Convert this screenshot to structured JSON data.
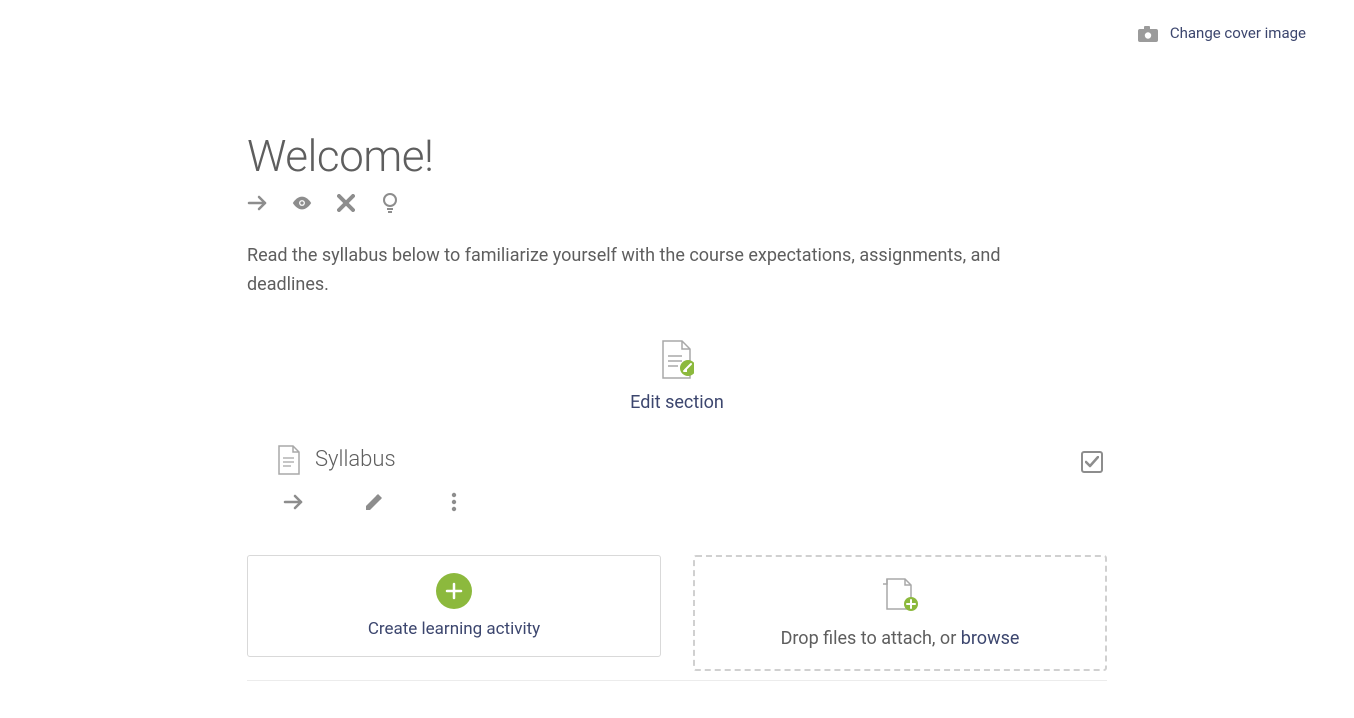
{
  "header": {
    "change_cover_label": "Change cover image"
  },
  "section": {
    "title": "Welcome!",
    "description": "Read the syllabus below to familiarize yourself with the course expectations, assignments, and deadlines.",
    "edit_label": "Edit section"
  },
  "item": {
    "title": "Syllabus"
  },
  "cards": {
    "create_label": "Create learning activity",
    "drop_prefix": "Drop files to attach, or ",
    "browse_label": "browse"
  },
  "colors": {
    "accent_green": "#8cb93d",
    "link_navy": "#3c466e",
    "icon_grey": "#8d8d8d",
    "text_grey": "#5e5e5e"
  }
}
